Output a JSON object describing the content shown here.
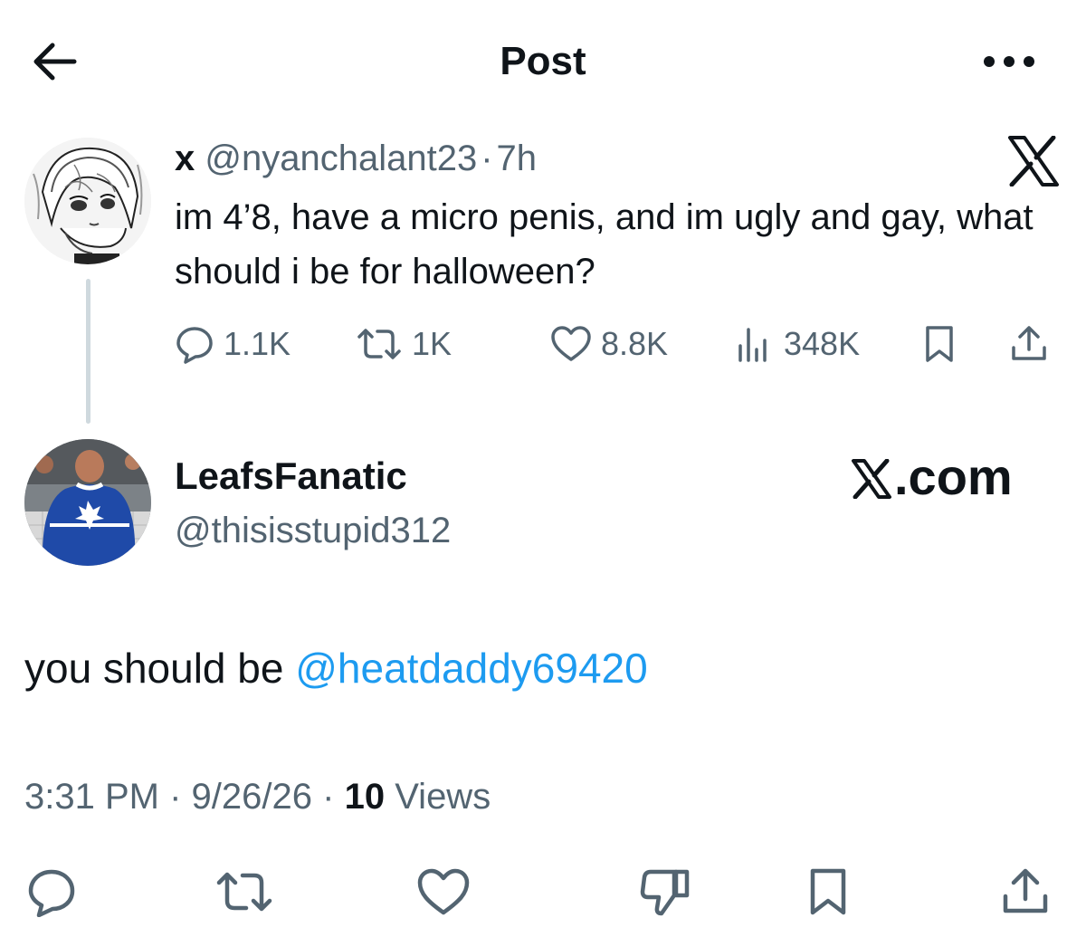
{
  "header": {
    "title": "Post",
    "back_icon": "arrow-left-icon",
    "more_icon": "more-horizontal-icon"
  },
  "quoted_post": {
    "author_name": "x",
    "author_handle": "@nyanchalant23",
    "separator": "·",
    "time": "7h",
    "text": "im 4’8, have a micro penis, and im ugly and gay, what should i be for halloween?",
    "stats": {
      "replies": "1.1K",
      "reposts": "1K",
      "likes": "8.8K",
      "views": "348K"
    }
  },
  "post": {
    "author_name": "LeafsFanatic",
    "author_handle": "@thisisstupid312",
    "source_label": ".com",
    "text_prefix": "you should be ",
    "mention": "@heatdaddy69420",
    "time": "3:31 PM",
    "date": "9/26/26",
    "separator": "·",
    "views_count": "10",
    "views_label": "Views"
  },
  "colors": {
    "text": "#0f1419",
    "secondary": "#536471",
    "link": "#1d9bf0",
    "thread_line": "#cfd9de"
  }
}
